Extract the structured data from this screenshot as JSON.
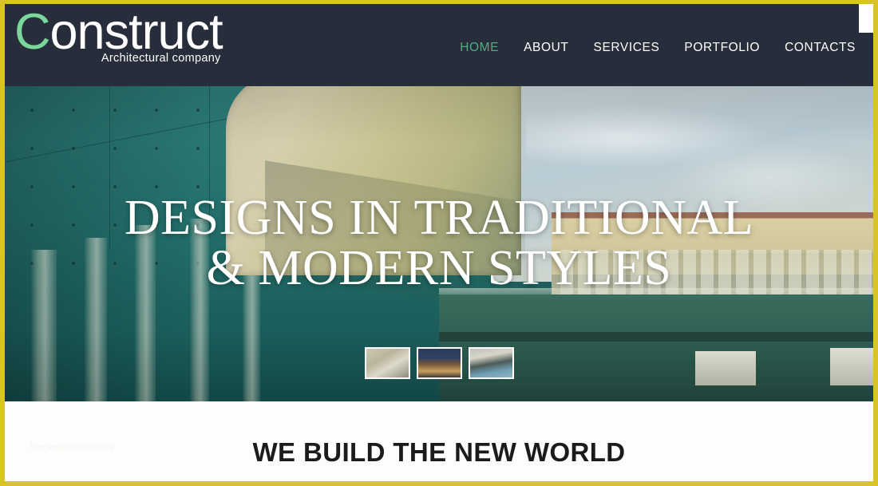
{
  "theme": {
    "frame_border_color": "#d8c328",
    "header_bg": "#282d3b",
    "accent_green": "#4caf7d",
    "logo_lead_color": "#7ad79b",
    "hero_teal": "#24706c",
    "section_bg": "#fdfdfb",
    "heading_color": "#1b1b1b"
  },
  "header": {
    "logo": {
      "lead_letter": "C",
      "rest": "onstruct",
      "full": "Construct",
      "tagline": "Architectural company"
    },
    "nav": [
      {
        "label": "HOME",
        "active": true
      },
      {
        "label": "ABOUT",
        "active": false
      },
      {
        "label": "SERVICES",
        "active": false
      },
      {
        "label": "PORTFOLIO",
        "active": false
      },
      {
        "label": "CONTACTS",
        "active": false
      }
    ]
  },
  "hero": {
    "heading_line1": "DESIGNS IN TRADITIONAL",
    "heading_line2": "& MODERN STYLES",
    "thumbnails": [
      {
        "name": "thumbnail-concrete-interior"
      },
      {
        "name": "thumbnail-dusk-house"
      },
      {
        "name": "thumbnail-modern-villa"
      }
    ]
  },
  "section": {
    "heading": "WE BUILD THE NEW WORLD",
    "watermark": "free website templates"
  }
}
